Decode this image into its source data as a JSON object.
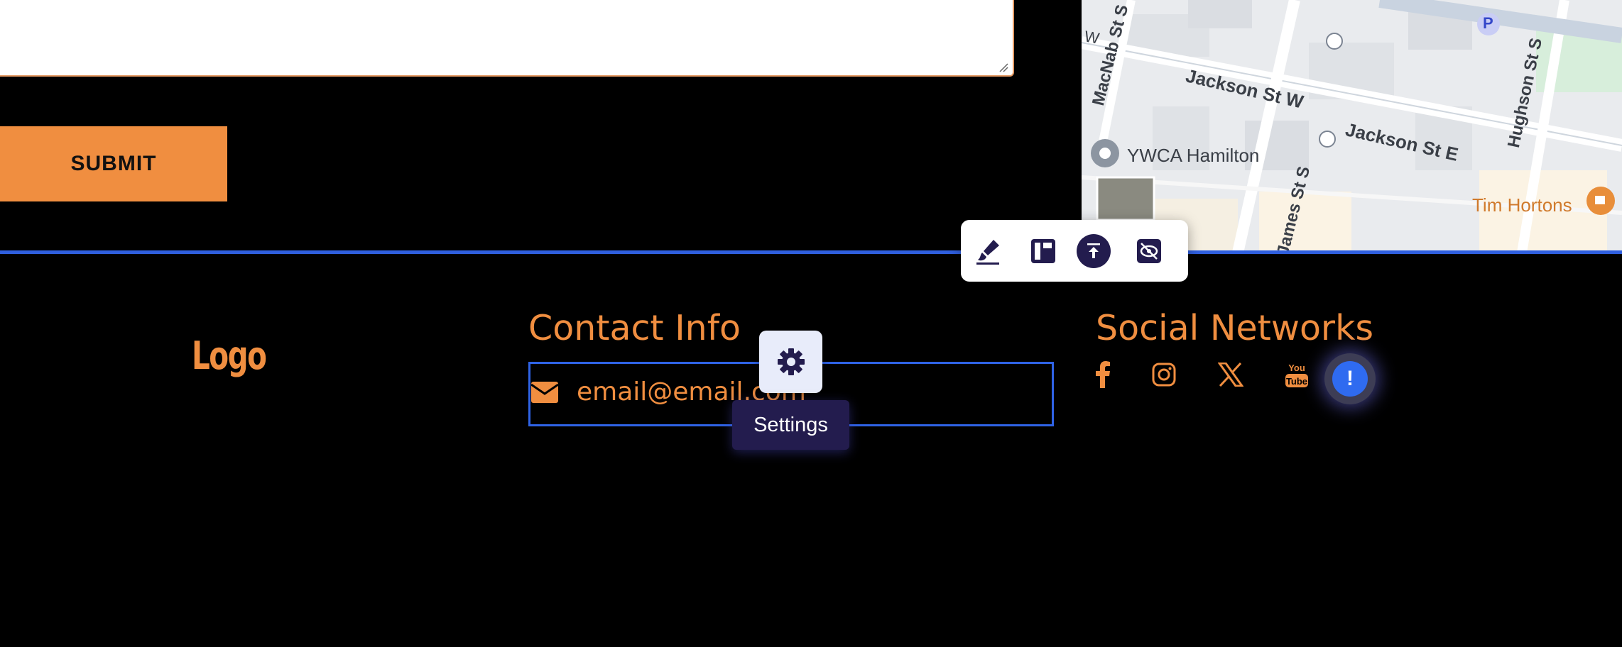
{
  "form": {
    "submit_label": "SUBMIT"
  },
  "map": {
    "streets": [
      "MacNab St S",
      "Jackson St W",
      "Jackson St E",
      "Hughson St S",
      "James St S"
    ],
    "places": [
      "YWCA Hamilton",
      "Tim Hortons"
    ],
    "parking_label": "P",
    "edge_label": "W"
  },
  "editor_toolbar": {
    "icons": [
      "brush-icon",
      "layout-icon",
      "move-to-top-icon",
      "hide-icon"
    ]
  },
  "footer": {
    "logo_text": "Logo",
    "contact_heading": "Contact Info",
    "email": "email@email.com",
    "social_heading": "Social Networks",
    "social_icons": [
      "facebook-icon",
      "instagram-icon",
      "x-icon",
      "youtube-icon"
    ]
  },
  "settings": {
    "tooltip": "Settings"
  },
  "alert": {
    "symbol": "!"
  },
  "colors": {
    "accent_orange": "#f08e40",
    "selection_blue": "#2f63e6",
    "toolbar_navy": "#231c4e"
  }
}
